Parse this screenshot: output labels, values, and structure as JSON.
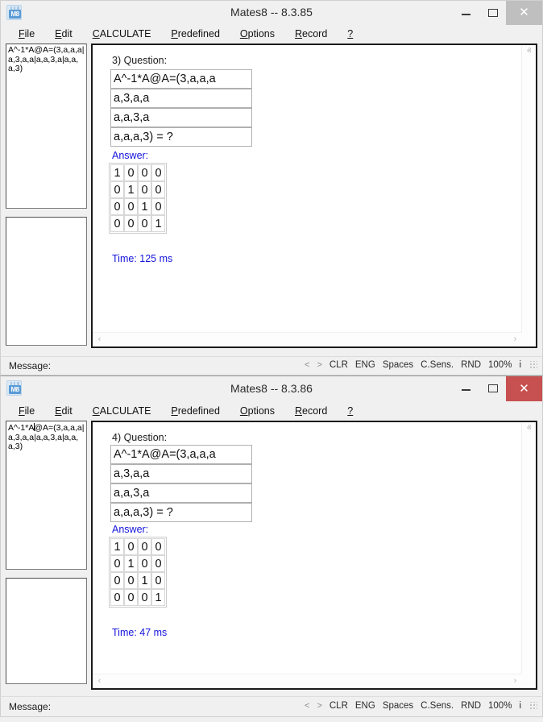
{
  "app": {
    "icon_label": "M8",
    "menu": [
      {
        "accel": "F",
        "rest": "ile"
      },
      {
        "accel": "E",
        "rest": "dit"
      },
      {
        "accel": "C",
        "rest": "ALCULATE"
      },
      {
        "accel": "P",
        "rest": "redefined"
      },
      {
        "accel": "O",
        "rest": "ptions"
      },
      {
        "accel": "R",
        "rest": "ecord"
      },
      {
        "accel": "?",
        "rest": ""
      }
    ],
    "captions": {
      "minimize": "–",
      "maximize": "□",
      "close": "✕"
    }
  },
  "window1": {
    "title": "Mates8 -- 8.3.85",
    "sidebar": {
      "input_text": "A^-1*A@A=(3,a,a,a|a,3,a,a|a,a,3,a|a,a,a,3)",
      "second_panel_text": ""
    },
    "content": {
      "question_label": "3) Question:",
      "question_lines": [
        "A^-1*A@A=(3,a,a,a",
        "a,3,a,a",
        "a,a,3,a",
        "a,a,a,3) = ?"
      ],
      "answer_label": "Answer:",
      "answer_matrix": [
        [
          "1",
          "0",
          "0",
          "0"
        ],
        [
          "0",
          "1",
          "0",
          "0"
        ],
        [
          "0",
          "0",
          "1",
          "0"
        ],
        [
          "0",
          "0",
          "0",
          "1"
        ]
      ],
      "time_label": "Time: 125 ms"
    },
    "statusbar": {
      "message": "Message:",
      "prev": "<",
      "next": ">",
      "items": [
        "CLR",
        "ENG",
        "Spaces",
        "C.Sens.",
        "RND",
        "100%",
        "i"
      ]
    }
  },
  "window2": {
    "title": "Mates8 -- 8.3.86",
    "sidebar": {
      "input_before_caret": "A^-1*A",
      "input_after_caret": "@A=(3,a,a,a|a,3,a,a|a,a,3,a|a,a,a,3)",
      "second_panel_text": ""
    },
    "content": {
      "question_label": "4) Question:",
      "question_lines": [
        "A^-1*A@A=(3,a,a,a",
        "a,3,a,a",
        "a,a,3,a",
        "a,a,a,3) = ?"
      ],
      "answer_label": "Answer:",
      "answer_matrix": [
        [
          "1",
          "0",
          "0",
          "0"
        ],
        [
          "0",
          "1",
          "0",
          "0"
        ],
        [
          "0",
          "0",
          "1",
          "0"
        ],
        [
          "0",
          "0",
          "0",
          "1"
        ]
      ],
      "time_label": "Time: 47 ms"
    },
    "statusbar": {
      "message": "Message:",
      "prev": "<",
      "next": ">",
      "items": [
        "CLR",
        "ENG",
        "Spaces",
        "C.Sens.",
        "RND",
        "100%",
        "i"
      ]
    }
  },
  "scrollbars": {
    "up": "ⱏ",
    "down": "ⱟ",
    "left": "‹",
    "right": "›"
  },
  "colors": {
    "accent_blue": "#1414dc",
    "close_active": "#c75050",
    "window_chrome": "#f0f0f0"
  }
}
